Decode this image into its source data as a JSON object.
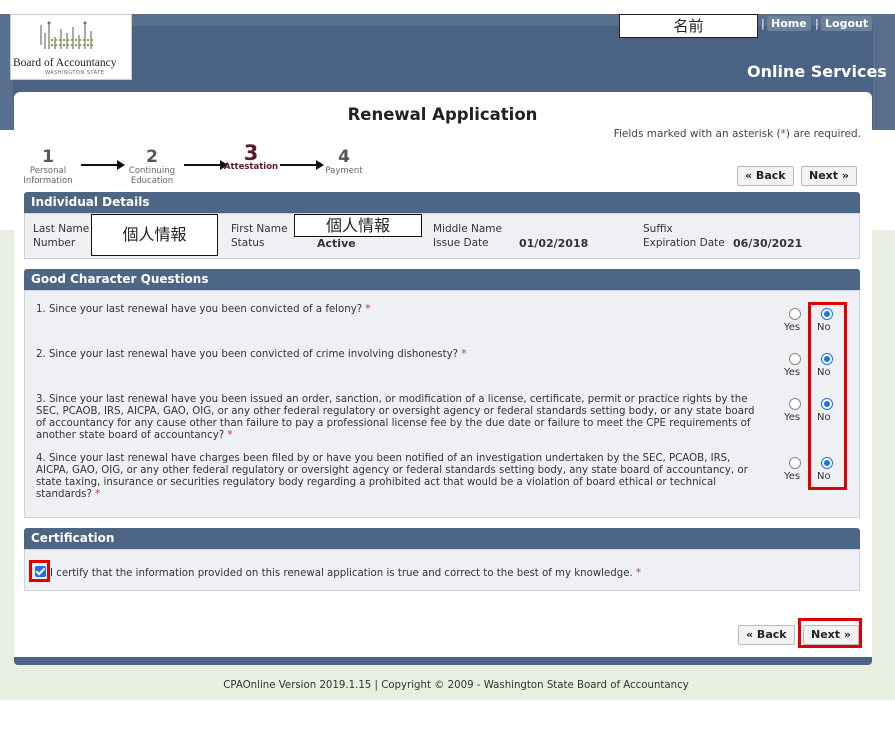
{
  "header": {
    "logo_text": "Board of Accountancy",
    "logo_sub": "WASHINGTON STATE",
    "user_name": "名前",
    "home_label": "Home",
    "logout_label": "Logout",
    "separator": "|",
    "online_services": "Online Services"
  },
  "page": {
    "title": "Renewal Application",
    "required_note_prefix": "Fields marked with an asterisk (",
    "required_star": "*",
    "required_note_suffix": ") are required."
  },
  "steps": [
    {
      "num": "1",
      "label": "Personal Information"
    },
    {
      "num": "2",
      "label": "Continuing Education"
    },
    {
      "num": "3",
      "label": "Attestation"
    },
    {
      "num": "4",
      "label": "Payment"
    }
  ],
  "nav": {
    "back": "« Back",
    "next": "Next »"
  },
  "individual": {
    "heading": "Individual Details",
    "last_name_label": "Last Name",
    "number_label": "Number",
    "last_name_value": "個人情報",
    "first_name_label": "First Name",
    "first_name_value": "個人情報",
    "status_label": "Status",
    "status_value": "Active",
    "middle_name_label": "Middle Name",
    "issue_date_label": "Issue Date",
    "issue_date_value": "01/02/2018",
    "suffix_label": "Suffix",
    "expiration_label": "Expiration Date",
    "expiration_value": "06/30/2021"
  },
  "good_character": {
    "heading": "Good Character Questions",
    "yes_label": "Yes",
    "no_label": "No",
    "questions": [
      {
        "text": "1.  Since your last renewal have you been convicted of a felony?",
        "answer": "No"
      },
      {
        "text": "2.  Since your last renewal have you been convicted of crime involving dishonesty?",
        "answer": "No"
      },
      {
        "text": "3.  Since your last renewal have you been issued an order, sanction, or modification of a license, certificate, permit or practice rights by the SEC, PCAOB, IRS, AICPA, GAO, OIG, or any other federal regulatory or oversight agency or federal standards setting body, or any state board of accountancy for any cause other than failure to pay a professional license fee by the due date or failure to meet the CPE requirements of another state board of accountancy?",
        "answer": "No"
      },
      {
        "text": "4.  Since your last renewal have charges been filed by or have you been notified of an investigation undertaken by the SEC, PCAOB, IRS, AICPA, GAO, OIG, or any other federal regulatory or oversight agency or federal standards setting body, any state board of accountancy, or state taxing, insurance or securities regulatory body regarding a prohibited act that would be a violation of board ethical or technical standards?",
        "answer": "No"
      }
    ]
  },
  "certification": {
    "heading": "Certification",
    "text": "I certify that the information provided on this renewal application is true and correct to the best of my knowledge.",
    "checked": true
  },
  "footer": {
    "text": "CPAOnline Version 2019.1.15 | Copyright © 2009 - Washington State Board of Accountancy"
  },
  "colors": {
    "header_blue": "#4a6283",
    "highlight_red": "#e00000",
    "required_red": "#d32f2f"
  }
}
